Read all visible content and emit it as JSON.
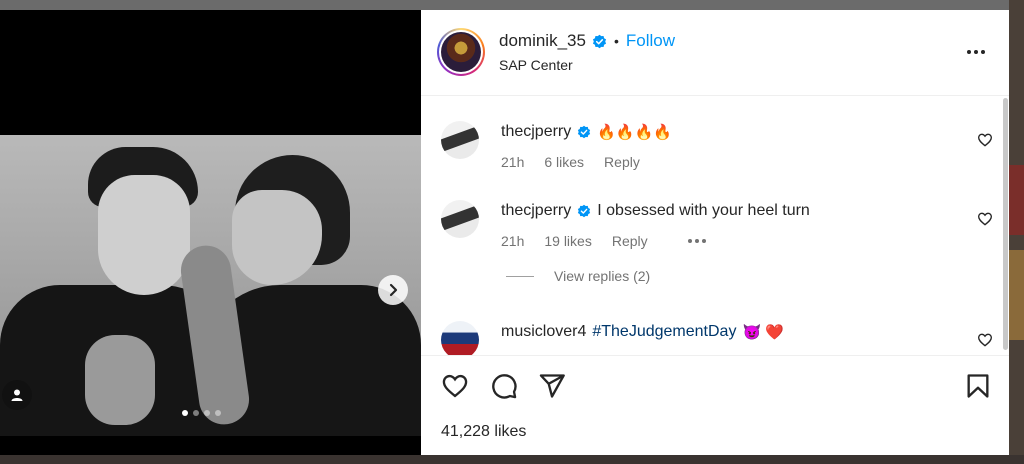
{
  "post": {
    "username": "dominik_35",
    "separator": "•",
    "follow_label": "Follow",
    "location": "SAP Center",
    "likes": "41,228 likes"
  },
  "comments": [
    {
      "username": "thecjperry",
      "text": "🔥🔥🔥🔥",
      "time": "21h",
      "likes": "6 likes",
      "reply": "Reply"
    },
    {
      "username": "thecjperry",
      "text": "I obsessed with your heel turn",
      "time": "21h",
      "likes": "19 likes",
      "reply": "Reply"
    },
    {
      "username": "musiclover4",
      "hashtag": "#TheJudgementDay",
      "emoji": "😈 ❤️"
    }
  ],
  "view_replies": "View replies (2)",
  "colors": {
    "accent": "#0095f6",
    "verified": "#0095f6",
    "hashtag": "#00376b",
    "muted": "#737373"
  },
  "icons": [
    "chevron-right-icon",
    "user-tag-icon",
    "more-icon",
    "heart-icon",
    "comment-icon",
    "share-icon",
    "bookmark-icon",
    "verified-badge-icon"
  ]
}
